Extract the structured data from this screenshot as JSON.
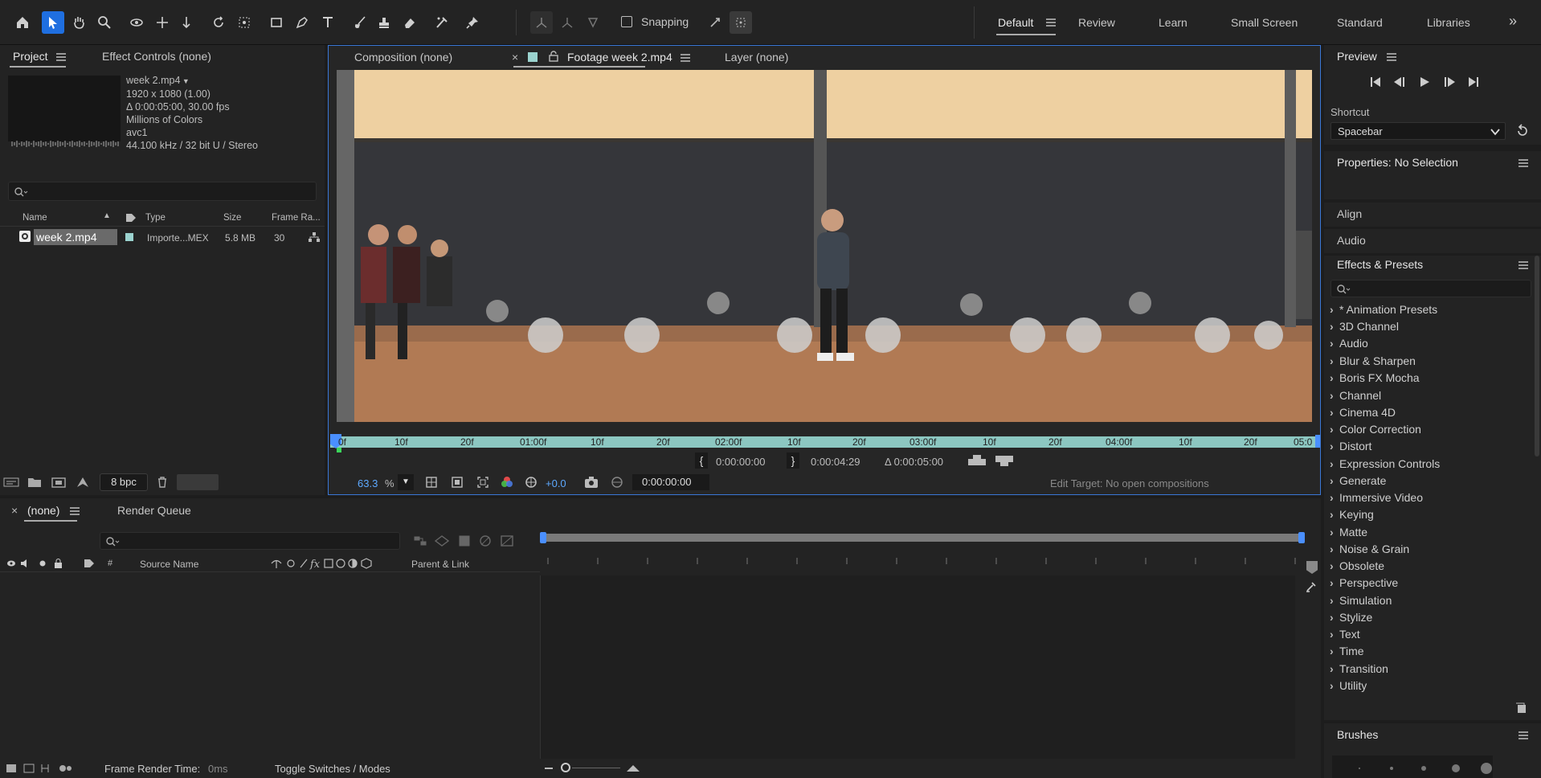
{
  "toolbar": {
    "snapping": "Snapping",
    "workspaces": [
      "Default",
      "Review",
      "Learn",
      "Small Screen",
      "Standard",
      "Libraries"
    ],
    "overflow": "»"
  },
  "project": {
    "tabs": [
      "Project",
      "Effect Controls (none)"
    ],
    "footage": {
      "name": "week 2.mp4",
      "dims": "1920 x 1080 (1.00)",
      "duration": "Δ 0:00:05:00, 30.00 fps",
      "colors": "Millions of Colors",
      "codec": "avc1",
      "audio": "44.100 kHz / 32 bit U / Stereo"
    },
    "columns": [
      "Name",
      "Type",
      "Size",
      "Frame Ra..."
    ],
    "row": {
      "name": "week 2.mp4",
      "type": "Importe...MEX",
      "size": "5.8 MB",
      "fps": "30"
    },
    "bpc": "8 bpc"
  },
  "viewer": {
    "tabs": [
      "Composition (none)",
      "Footage week 2.mp4",
      "Layer (none)"
    ],
    "ruler": [
      "0f",
      "10f",
      "20f",
      "01:00f",
      "10f",
      "20f",
      "02:00f",
      "10f",
      "20f",
      "03:00f",
      "10f",
      "20f",
      "04:00f",
      "10f",
      "20f",
      "05:0"
    ],
    "in": "0:00:00:00",
    "out": "0:00:04:29",
    "dur": "Δ 0:00:05:00",
    "zoom": "63.3",
    "zoom_unit": "%",
    "exposure": "+0.0",
    "timecode": "0:00:00:00",
    "edit_target": "Edit Target: No open compositions"
  },
  "right": {
    "preview": "Preview",
    "shortcut_label": "Shortcut",
    "shortcut_value": "Spacebar",
    "properties": "Properties: No Selection",
    "align": "Align",
    "audio": "Audio",
    "effects": "Effects & Presets",
    "effect_items": [
      "* Animation Presets",
      "3D Channel",
      "Audio",
      "Blur & Sharpen",
      "Boris FX Mocha",
      "Channel",
      "Cinema 4D",
      "Color Correction",
      "Distort",
      "Expression Controls",
      "Generate",
      "Immersive Video",
      "Keying",
      "Matte",
      "Noise & Grain",
      "Obsolete",
      "Perspective",
      "Simulation",
      "Stylize",
      "Text",
      "Time",
      "Transition",
      "Utility"
    ],
    "brushes": "Brushes"
  },
  "timeline": {
    "tabs": [
      "(none)",
      "Render Queue"
    ],
    "cols": {
      "source": "Source Name",
      "parent": "Parent & Link",
      "num": "#"
    }
  },
  "status": {
    "render_label": "Frame Render Time:",
    "render_value": "0ms",
    "toggle": "Toggle Switches / Modes"
  }
}
